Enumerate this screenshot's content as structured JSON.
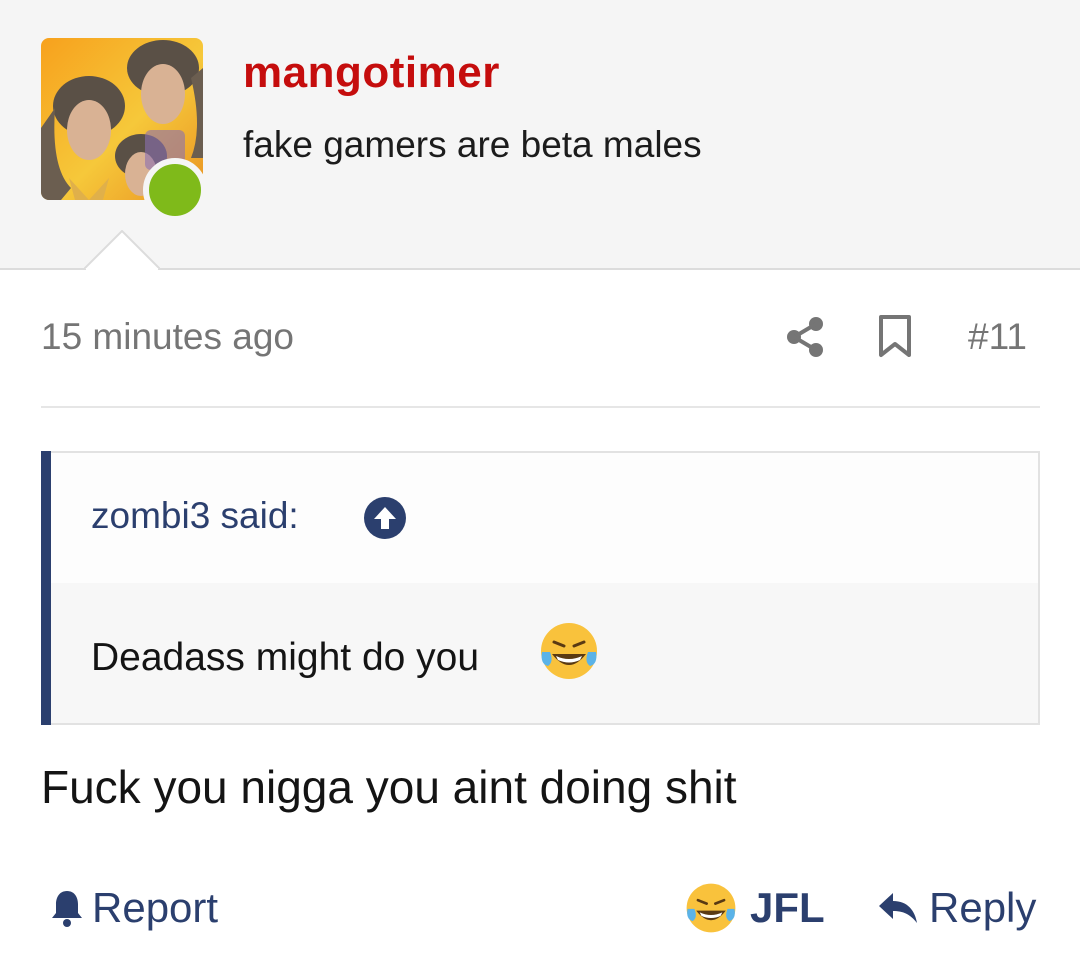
{
  "user": {
    "username": "mangotimer",
    "title": "fake gamers are beta males",
    "online": true
  },
  "post": {
    "time": "15 minutes ago",
    "number": "#11",
    "quote": {
      "author_line": "zombi3 said:",
      "text": "Deadass might do you"
    },
    "message": "Fuck you nigga you aint doing shit"
  },
  "actions": {
    "report": "Report",
    "reaction": "JFL",
    "reply": "Reply"
  },
  "icons": {
    "share": "share-icon",
    "bookmark": "bookmark-icon",
    "quote_jump": "arrow-up-circle-icon",
    "report": "bell-icon",
    "reaction_emoji": "tears-of-joy-emoji",
    "reply": "reply-arrow-icon"
  },
  "colors": {
    "username": "#c50d0d",
    "accent": "#2b3f6e",
    "online": "#7fba1a",
    "muted": "#757575"
  }
}
